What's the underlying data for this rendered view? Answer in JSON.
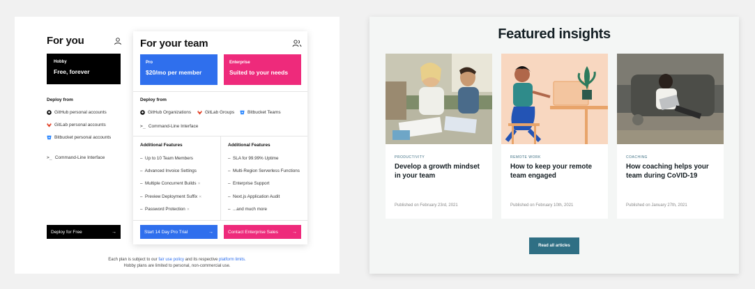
{
  "pricing": {
    "for_you": {
      "title": "For you",
      "plan_small": "Hobby",
      "plan_big": "Free, forever",
      "deploy_heading": "Deploy from",
      "deploy_items": [
        "GitHub personal accounts",
        "GitLab personal accounts",
        "Bitbucket personal accounts",
        "Command-Line Interface"
      ],
      "cta": "Deploy for Free"
    },
    "for_team": {
      "title": "For your team",
      "pro_small": "Pro",
      "pro_big": "$20/mo per member",
      "ent_small": "Enterprise",
      "ent_big": "Suited to your needs",
      "deploy_heading": "Deploy from",
      "deploy_items": [
        "GitHub Organizations",
        "GitLab Groups",
        "Bitbucket Teams",
        "Command-Line Interface"
      ],
      "features_left_heading": "Additional Features",
      "features_left": [
        "Up to 10 Team Members",
        "Advanced Invoice Settings",
        "Multiple Concurrent Builds",
        "Preview Deployment Suffix",
        "Password Protection"
      ],
      "features_right_heading": "Additional Features",
      "features_right": [
        "SLA for 99.99% Uptime",
        "Multi-Region Serverless Functions",
        "Enterprise Support",
        "Next.js Application Audit",
        "...and much more"
      ],
      "cta_pro": "Start 14 Day Pro Trial",
      "cta_ent": "Contact Enterprise Sales"
    },
    "footnote": {
      "prefix": "Each plan is subject to our ",
      "link1": "fair use policy",
      "middle": " and its respective ",
      "link2": "platform limits.",
      "line2": "Hobby plans are limited to personal, non-commercial use."
    }
  },
  "insights": {
    "title": "Featured insights",
    "articles": [
      {
        "category": "Productivity",
        "title": "Develop a growth mindset in your team",
        "date": "Published on February 23rd, 2021"
      },
      {
        "category": "Remote Work",
        "title": "How to keep your remote team engaged",
        "date": "Published on February 10th, 2021"
      },
      {
        "category": "Coaching",
        "title": "How coaching helps your team during CoVID-19",
        "date": "Published on January 27th, 2021"
      }
    ],
    "read_all": "Read all articles"
  },
  "colors": {
    "pro_blue": "#2f6fed",
    "enterprise_pink": "#ee2a7b",
    "read_btn": "#2f6f84",
    "category_text": "#3a6c80"
  }
}
